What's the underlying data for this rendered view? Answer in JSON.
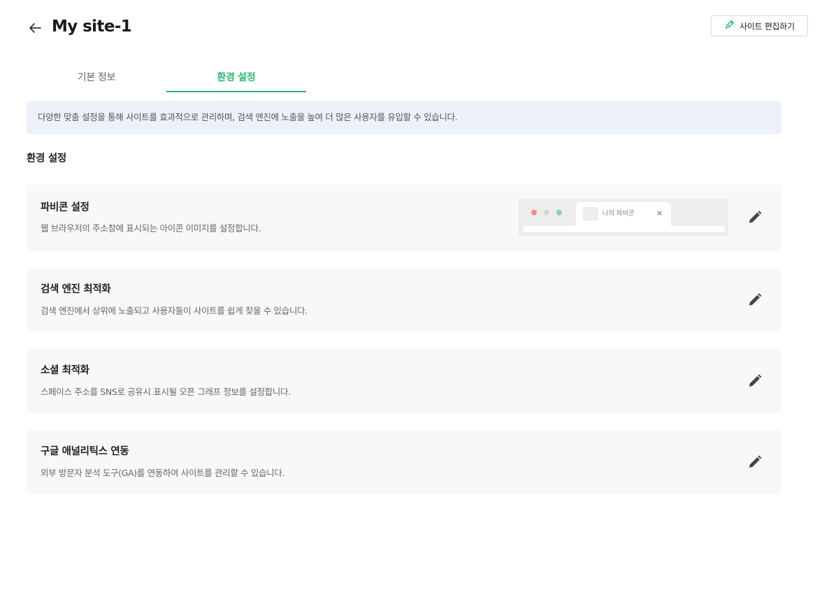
{
  "header": {
    "back_icon": "arrow-left-icon",
    "title": "My site-1",
    "edit_button": {
      "icon": "edit-pen-icon",
      "label": "사이트 편집하기",
      "icon_color": "#2bb673"
    }
  },
  "tabs": [
    {
      "label": "기본 정보",
      "active": false
    },
    {
      "label": "환경 설정",
      "active": true
    }
  ],
  "accent_color": "#2bb673",
  "info_banner": {
    "text": "다양한 맞춤 설정을 통해 사이트를 효과적으로 관리하며, 검색 엔진에 노출을 높여 더 많은 사용자를 유입할 수 있습니다."
  },
  "section": {
    "title": "환경 설정"
  },
  "settings": [
    {
      "title": "파비콘 설정",
      "description": "웹 브라우저의 주소창에 표시되는 아이콘 이미지를 설정합니다.",
      "edit_icon": "pencil-icon",
      "preview": {
        "tab_label": "나의 파비콘",
        "close_glyph": "✕"
      }
    },
    {
      "title": "검색 엔진 최적화",
      "description": "검색 엔진에서 상위에 노출되고 사용자들이 사이트를 쉽게 찾을 수 있습니다.",
      "edit_icon": "pencil-icon"
    },
    {
      "title": "소셜 최적화",
      "description": "스페이스 주소를 SNS로 공유시 표시될 오픈 그래프 정보를 설정합니다.",
      "edit_icon": "pencil-icon"
    },
    {
      "title": "구글 애널리틱스 연동",
      "description": "외부 방문자 분석 도구(GA)를 연동하여 사이트를 관리할 수 있습니다.",
      "edit_icon": "pencil-icon"
    }
  ]
}
